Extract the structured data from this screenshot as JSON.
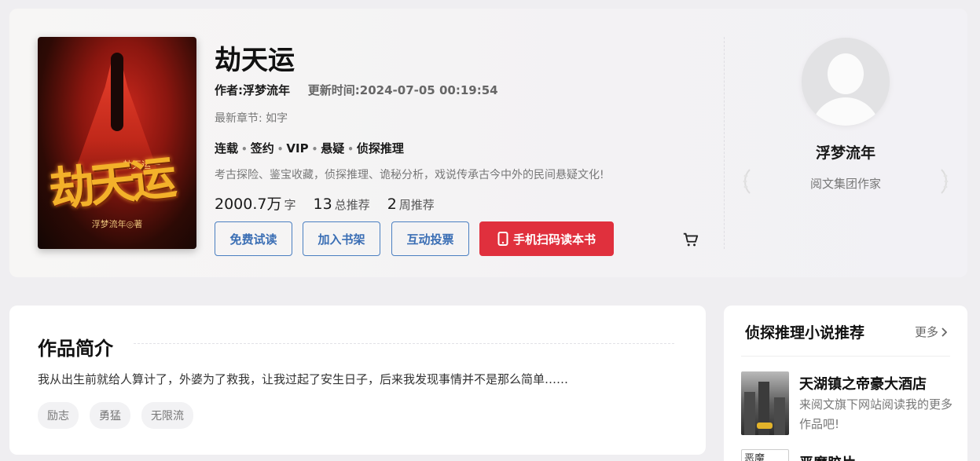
{
  "book": {
    "title": "劫天运",
    "author": "作者:浮梦流年",
    "update_time": "更新时间:2024-07-05 00:19:54",
    "latest_chapter": "最新章节: 如字",
    "tags": [
      "连载",
      "签约",
      "VIP",
      "悬疑",
      "侦探推理"
    ],
    "tagline": "考古探险、鉴宝收藏，侦探推理、诡秘分析，戏说传承古今中外的民间悬疑文化!",
    "stats": [
      {
        "num": "2000.7万",
        "unit": "字"
      },
      {
        "num": "13",
        "unit": "总推荐"
      },
      {
        "num": "2",
        "unit": "周推荐"
      }
    ],
    "cover": {
      "title": "劫天运",
      "subtitle": "一劫天运一",
      "author": "浮梦流年◎著"
    }
  },
  "actions": {
    "trial": "免费试读",
    "shelf": "加入书架",
    "vote": "互动投票",
    "mobile": "手机扫码读本书"
  },
  "author_panel": {
    "name": "浮梦流年",
    "title": "阅文集团作家"
  },
  "intro": {
    "heading": "作品简介",
    "text": "我从出生前就给人算计了，外婆为了救我，让我过起了安生日子，后来我发现事情并不是那么简单……",
    "chips": [
      "励志",
      "勇猛",
      "无限流"
    ]
  },
  "recommend": {
    "heading": "侦探推理小说推荐",
    "more": "更多",
    "items": [
      {
        "name": "天湖镇之帝豪大酒店",
        "desc": "来阅文旗下网站阅读我的更多作品吧!"
      },
      {
        "name": "恶魔胶片",
        "cover_alt": "恶魔"
      }
    ]
  },
  "colors": {
    "accent_blue": "#3a6eb4",
    "accent_red": "#e0303d",
    "background": "#efeef1"
  }
}
